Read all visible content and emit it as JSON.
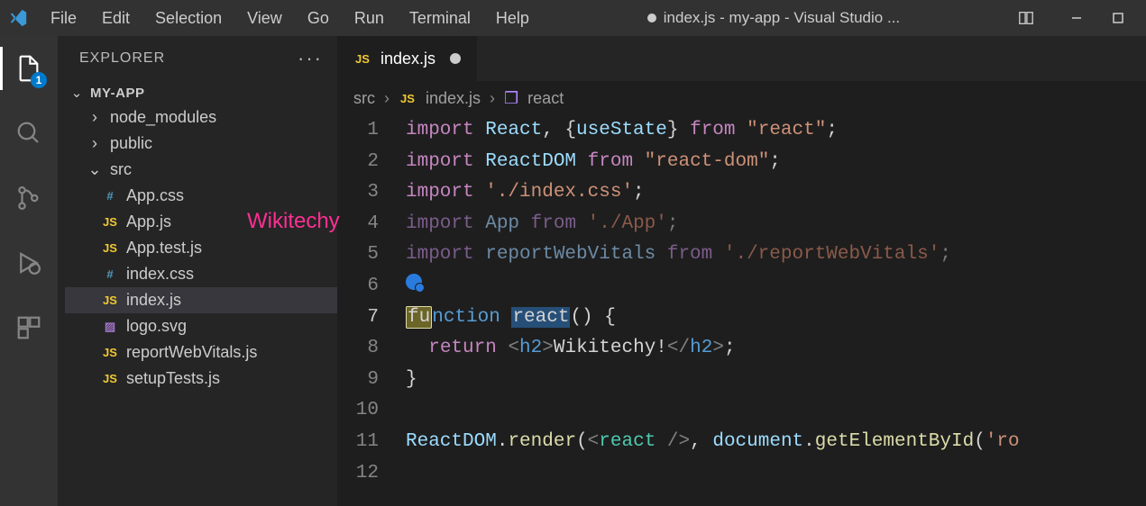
{
  "menus": [
    "File",
    "Edit",
    "Selection",
    "View",
    "Go",
    "Run",
    "Terminal",
    "Help"
  ],
  "title": "index.js - my-app - Visual Studio ...",
  "title_dirty": true,
  "activity_badge": "1",
  "sidebar": {
    "title": "EXPLORER",
    "root": "MY-APP",
    "items": [
      {
        "kind": "folder",
        "name": "node_modules",
        "open": false,
        "nested": false
      },
      {
        "kind": "folder",
        "name": "public",
        "open": false,
        "nested": false
      },
      {
        "kind": "folder",
        "name": "src",
        "open": true,
        "nested": false
      },
      {
        "kind": "file",
        "name": "App.css",
        "icon": "css",
        "nested": true
      },
      {
        "kind": "file",
        "name": "App.js",
        "icon": "js",
        "nested": true
      },
      {
        "kind": "file",
        "name": "App.test.js",
        "icon": "js",
        "nested": true
      },
      {
        "kind": "file",
        "name": "index.css",
        "icon": "css",
        "nested": true
      },
      {
        "kind": "file",
        "name": "index.js",
        "icon": "js",
        "nested": true,
        "active": true
      },
      {
        "kind": "file",
        "name": "logo.svg",
        "icon": "svg",
        "nested": true
      },
      {
        "kind": "file",
        "name": "reportWebVitals.js",
        "icon": "js",
        "nested": true
      },
      {
        "kind": "file",
        "name": "setupTests.js",
        "icon": "js",
        "nested": true
      }
    ]
  },
  "watermark": "Wikitechy",
  "tab": {
    "label": "index.js",
    "dirty": true
  },
  "breadcrumbs": {
    "folder": "src",
    "file": "index.js",
    "symbol": "react"
  },
  "line_numbers": [
    "1",
    "2",
    "3",
    "4",
    "5",
    "6",
    "7",
    "8",
    "9",
    "10",
    "11",
    "12"
  ],
  "code": {
    "l1_import": "import ",
    "l1_react": "React",
    "l1_comma": ", {",
    "l1_use": "useState",
    "l1_brace": "} ",
    "l1_from": "from ",
    "l1_str": "\"react\"",
    "l1_semi": ";",
    "l2_import": "import ",
    "l2_rd": "ReactDOM",
    "l2_from": " from ",
    "l2_str": "\"react-dom\"",
    "l2_semi": ";",
    "l3_import": "import ",
    "l3_str": "'./index.css'",
    "l3_semi": ";",
    "l4_import": "import ",
    "l4_app": "App",
    "l4_from": " from ",
    "l4_str": "'./App'",
    "l4_semi": ";",
    "l5_import": "import ",
    "l5_rwv": "reportWebVitals",
    "l5_from": " from ",
    "l5_str": "'./reportWebVitals'",
    "l5_semi": ";",
    "l7_fu": "fu",
    "l7_nction": "nction ",
    "l7_name": "react",
    "l7_paren": "() {",
    "l8_indent": "  ",
    "l8_return": "return ",
    "l8_lt": "<",
    "l8_h2o": "h2",
    "l8_gt": ">",
    "l8_text": "Wikitechy!",
    "l8_lt2": "</",
    "l8_h2c": "h2",
    "l8_gt2": ">",
    "l8_semi": ";",
    "l9_close": "}",
    "l11_rd": "ReactDOM",
    "l11_dot": ".",
    "l11_render": "render",
    "l11_open": "(",
    "l11_lt": "<",
    "l11_comp": "react",
    "l11_sp": " ",
    "l11_slash": "/",
    "l11_gt": ">",
    "l11_comma": ", ",
    "l11_doc": "document",
    "l11_dot2": ".",
    "l11_gebi": "getElementById",
    "l11_open2": "(",
    "l11_str": "'ro"
  }
}
